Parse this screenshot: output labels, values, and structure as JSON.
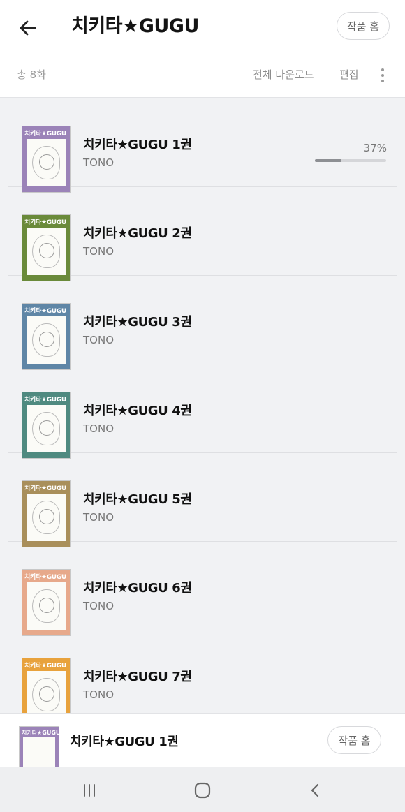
{
  "header": {
    "title": "치키타★GUGU",
    "home_label": "작품 홈",
    "total_label": "총 8화",
    "download_all_label": "전체 다운로드",
    "edit_label": "편집"
  },
  "episodes": [
    {
      "title": "치키타★GUGU 1권",
      "author": "TONO",
      "progress_label": "37%",
      "progress": 0.37,
      "cover_color": "#9b83b8",
      "cover_text": "치키타★GUGU"
    },
    {
      "title": "치키타★GUGU 2권",
      "author": "TONO",
      "cover_color": "#6a8a3a",
      "cover_text": "치키타★GUGU"
    },
    {
      "title": "치키타★GUGU 3권",
      "author": "TONO",
      "cover_color": "#5f86a6",
      "cover_text": "치키타★GUGU"
    },
    {
      "title": "치키타★GUGU 4권",
      "author": "TONO",
      "cover_color": "#4f8a80",
      "cover_text": "치키타★GUGU"
    },
    {
      "title": "치키타★GUGU 5권",
      "author": "TONO",
      "cover_color": "#a98f5b",
      "cover_text": "치키타★GUGU"
    },
    {
      "title": "치키타★GUGU 6권",
      "author": "TONO",
      "cover_color": "#e7a98b",
      "cover_text": "치키타★GUGU"
    },
    {
      "title": "치키타★GUGU 7권",
      "author": "TONO",
      "cover_color": "#e8a23c",
      "cover_text": "치키타★GUGU"
    }
  ],
  "now_reading": {
    "title": "치키타★GUGU 1권",
    "home_label": "작품 홈",
    "cover_text": "치키타★GUGU"
  },
  "icons": {
    "back": "arrow-left-icon",
    "more": "more-vertical-icon",
    "nav_recent": "recent-apps-icon",
    "nav_home": "home-icon",
    "nav_back": "chevron-left-icon"
  }
}
